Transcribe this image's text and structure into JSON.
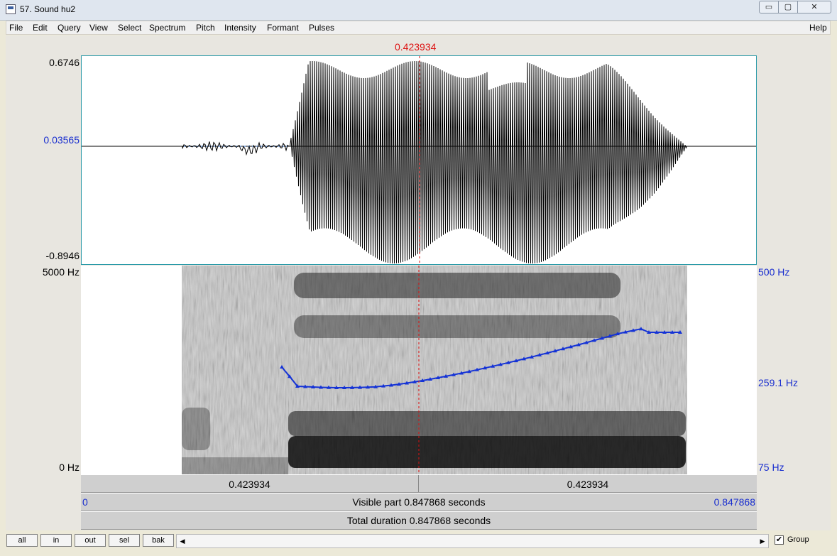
{
  "window": {
    "title": "57. Sound hu2",
    "controls": {
      "minimize": "▭",
      "maximize": "▢",
      "close": "✕"
    }
  },
  "menu": [
    "File",
    "Edit",
    "Query",
    "View",
    "Select",
    "Spectrum",
    "Pitch",
    "Intensity",
    "Formant",
    "Pulses"
  ],
  "menu_help": "Help",
  "cursor_time": "0.423934",
  "waveform": {
    "y_max": "0.6746",
    "y_zero": "0.03565",
    "y_min": "-0.8946"
  },
  "spectrogram": {
    "freq_max": "5000 Hz",
    "freq_min": "0 Hz",
    "pitch_max": "500 Hz",
    "pitch_cursor": "259.1 Hz",
    "pitch_min": "75 Hz"
  },
  "bars": {
    "left_segment": "0.423934",
    "right_segment": "0.423934",
    "visible_start": "0",
    "visible_label": "Visible part 0.847868 seconds",
    "visible_end": "0.847868",
    "total_label": "Total duration 0.847868 seconds"
  },
  "buttons": {
    "all": "all",
    "in": "in",
    "out": "out",
    "sel": "sel",
    "bak": "bak"
  },
  "scroll": {
    "left_arrow": "◀",
    "right_arrow": "▶"
  },
  "group": {
    "label": "Group",
    "checked": "✔"
  },
  "colors": {
    "accent_blue": "#1a2fcf",
    "cursor_red": "#d11111",
    "pitch_line": "#1533d6"
  }
}
